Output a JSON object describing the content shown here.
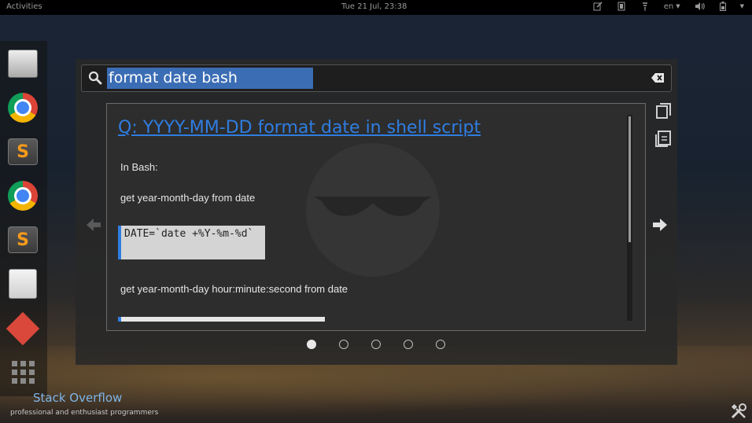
{
  "topbar": {
    "activities": "Activities",
    "clock": "Tue 21 Jul, 23:38",
    "language": "en"
  },
  "dock": {
    "items": [
      {
        "name": "drive-icon"
      },
      {
        "name": "chrome-icon"
      },
      {
        "name": "sublime-text-icon"
      },
      {
        "name": "chrome-icon"
      },
      {
        "name": "sublime-text-icon"
      },
      {
        "name": "notes-icon"
      },
      {
        "name": "git-icon"
      },
      {
        "name": "app-grid-icon"
      }
    ]
  },
  "search": {
    "query": "format date bash"
  },
  "result": {
    "title": "Q: YYYY-MM-DD format date in shell script",
    "intro": "In Bash:",
    "step1": "get year-month-day from date",
    "code1": "DATE=`date +%Y-%m-%d`",
    "step2": "get year-month-day hour:minute:second from date"
  },
  "pager": {
    "count": 5,
    "active_index": 0
  },
  "brand": {
    "name": "Stack Overflow",
    "tagline": "professional and enthusiast programmers"
  },
  "colors": {
    "link": "#2f7de1",
    "selection": "#3b6db5",
    "panel": "#2d2d2d"
  }
}
